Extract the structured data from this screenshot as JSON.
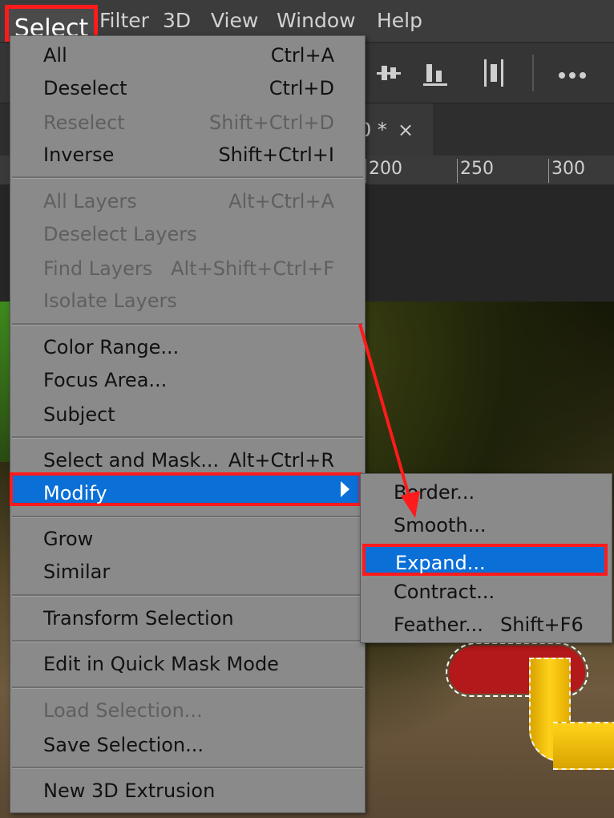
{
  "menubar": {
    "items": [
      {
        "label": "Select",
        "active": true
      },
      {
        "label": "Filter"
      },
      {
        "label": "3D"
      },
      {
        "label": "View"
      },
      {
        "label": "Window"
      },
      {
        "label": "Help"
      }
    ]
  },
  "document_tab": {
    "label": "0 *",
    "close": "×"
  },
  "ruler": {
    "labels": [
      "200",
      "250",
      "300"
    ]
  },
  "select_menu": {
    "items": [
      {
        "label": "All",
        "shortcut": "Ctrl+A"
      },
      {
        "label": "Deselect",
        "shortcut": "Ctrl+D"
      },
      {
        "label": "Reselect",
        "shortcut": "Shift+Ctrl+D",
        "disabled": true
      },
      {
        "label": "Inverse",
        "shortcut": "Shift+Ctrl+I"
      },
      {
        "label": "All Layers",
        "shortcut": "Alt+Ctrl+A",
        "disabled": true
      },
      {
        "label": "Deselect Layers",
        "disabled": true
      },
      {
        "label": "Find Layers",
        "shortcut": "Alt+Shift+Ctrl+F",
        "disabled": true
      },
      {
        "label": "Isolate Layers",
        "disabled": true
      },
      {
        "label": "Color Range..."
      },
      {
        "label": "Focus Area..."
      },
      {
        "label": "Subject"
      },
      {
        "label": "Select and Mask...",
        "shortcut": "Alt+Ctrl+R"
      },
      {
        "label": "Modify",
        "highlighted": true
      },
      {
        "label": "Grow"
      },
      {
        "label": "Similar"
      },
      {
        "label": "Transform Selection"
      },
      {
        "label": "Edit in Quick Mask Mode"
      },
      {
        "label": "Load Selection...",
        "disabled": true
      },
      {
        "label": "Save Selection..."
      },
      {
        "label": "New 3D Extrusion"
      }
    ]
  },
  "modify_submenu": {
    "items": [
      {
        "label": "Border..."
      },
      {
        "label": "Smooth..."
      },
      {
        "label": "Expand...",
        "highlighted": true
      },
      {
        "label": "Contract..."
      },
      {
        "label": "Feather...",
        "shortcut": "Shift+F6"
      }
    ]
  },
  "colors": {
    "highlight": "#0a6fd6",
    "annotation_red": "#ff1b1b",
    "menu_bg": "#8a8a8a"
  }
}
